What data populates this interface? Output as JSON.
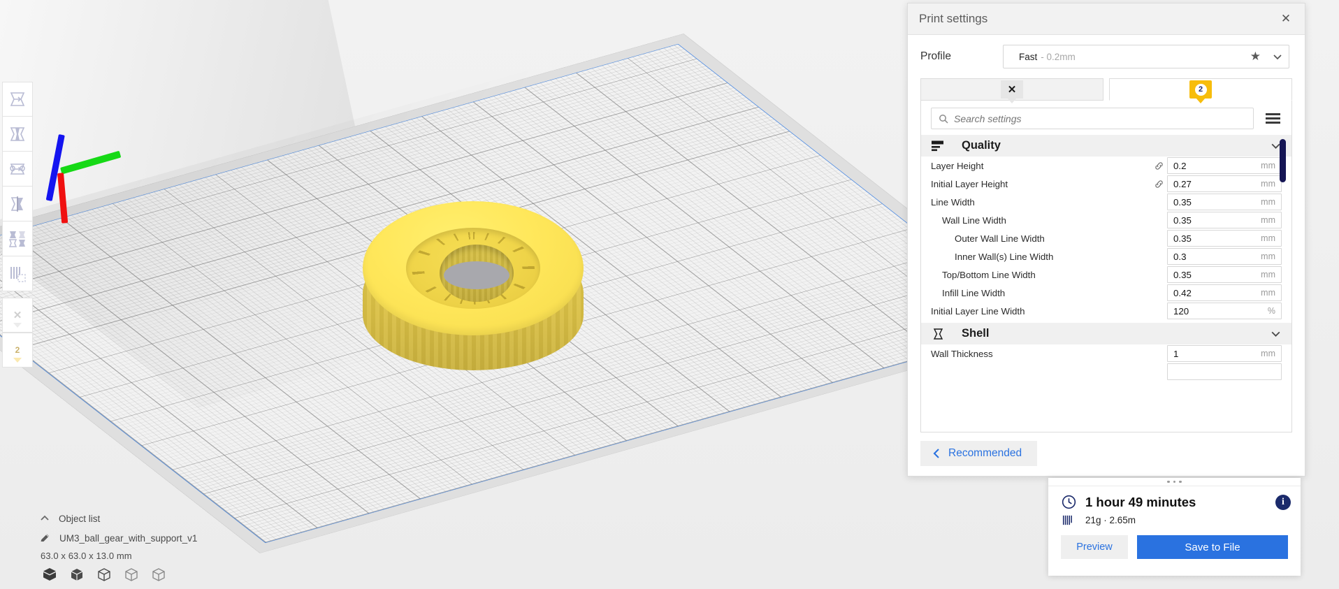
{
  "viewport": {
    "model_color": "#ffe75a",
    "axis": {
      "x_color": "#f01010",
      "y_color": "#16d916",
      "z_color": "#1414f0"
    }
  },
  "toolbar": {
    "items": [
      {
        "name": "move-tool",
        "label": "Move"
      },
      {
        "name": "scale-tool",
        "label": "Scale"
      },
      {
        "name": "rotate-tool",
        "label": "Rotate"
      },
      {
        "name": "mirror-tool",
        "label": "Mirror"
      },
      {
        "name": "per-model-settings-tool",
        "label": "Per Model Settings"
      },
      {
        "name": "support-blocker-tool",
        "label": "Support Blocker"
      }
    ],
    "badges": [
      {
        "name": "support-blocker-badge",
        "label": "✕",
        "color": "#e6e6e6"
      },
      {
        "name": "per-model-settings-badge",
        "label": "2",
        "color": "#fbe9b0"
      }
    ]
  },
  "object_list": {
    "toggle_label": "Object list",
    "object_name": "UM3_ball_gear_with_support_v1",
    "dimensions": "63.0 x 63.0 x 13.0 mm",
    "view_icons": [
      "solid-view-icon",
      "xray-view-icon",
      "wireframe-view-icon",
      "layer-view-icon",
      "simulation-view-icon"
    ]
  },
  "print_settings": {
    "title": "Print settings",
    "close_label": "✕",
    "profile": {
      "label": "Profile",
      "value": "Fast",
      "sub_value": "- 0.2mm",
      "star_icon": "★"
    },
    "tabs": [
      {
        "name": "tab-support-blocker",
        "badge": "✕",
        "badge_color": "#e6e6e6",
        "active": false
      },
      {
        "name": "tab-per-model-settings",
        "badge": "2",
        "badge_color": "#f7bd0c",
        "active": true
      }
    ],
    "search": {
      "placeholder": "Search settings",
      "value": ""
    },
    "menu_icon": "hamburger-icon",
    "categories": [
      {
        "name": "Quality",
        "icon": "quality-icon",
        "expanded": true,
        "settings": [
          {
            "label": "Layer Height",
            "value": "0.2",
            "unit": "mm",
            "indent": 0,
            "linked": true
          },
          {
            "label": "Initial Layer Height",
            "value": "0.27",
            "unit": "mm",
            "indent": 0,
            "linked": true
          },
          {
            "label": "Line Width",
            "value": "0.35",
            "unit": "mm",
            "indent": 0,
            "linked": false
          },
          {
            "label": "Wall Line Width",
            "value": "0.35",
            "unit": "mm",
            "indent": 1,
            "linked": false
          },
          {
            "label": "Outer Wall Line Width",
            "value": "0.35",
            "unit": "mm",
            "indent": 2,
            "linked": false
          },
          {
            "label": "Inner Wall(s) Line Width",
            "value": "0.3",
            "unit": "mm",
            "indent": 2,
            "linked": false
          },
          {
            "label": "Top/Bottom Line Width",
            "value": "0.35",
            "unit": "mm",
            "indent": 1,
            "linked": false
          },
          {
            "label": "Infill Line Width",
            "value": "0.42",
            "unit": "mm",
            "indent": 1,
            "linked": false
          },
          {
            "label": "Initial Layer Line Width",
            "value": "120",
            "unit": "%",
            "indent": 0,
            "linked": false
          }
        ]
      },
      {
        "name": "Shell",
        "icon": "shell-icon",
        "expanded": true,
        "settings": [
          {
            "label": "Wall Thickness",
            "value": "1",
            "unit": "mm",
            "indent": 0,
            "linked": false
          }
        ]
      }
    ],
    "recommended_button": "Recommended"
  },
  "job_info": {
    "time": "1 hour 49 minutes",
    "material": "21g · 2.65m",
    "clock_icon": "clock-icon",
    "material_icon": "material-spool-icon",
    "info_icon": "info-icon",
    "preview_button": "Preview",
    "save_button": "Save to File",
    "accent_color": "#2a72e0"
  }
}
